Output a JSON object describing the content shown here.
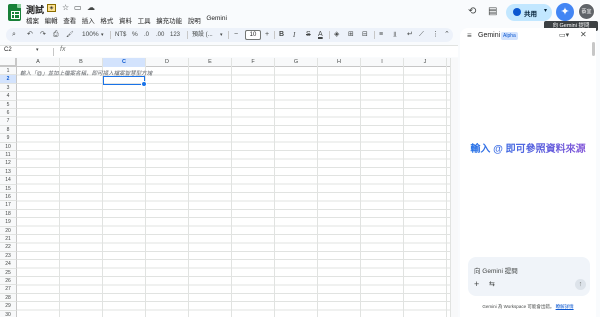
{
  "app": {
    "doc_title": "測試",
    "menu": [
      "檔案",
      "編輯",
      "查看",
      "插入",
      "格式",
      "資料",
      "工具",
      "擴充功能",
      "說明",
      "Gemini"
    ]
  },
  "header": {
    "share_label": "共用",
    "avatar_label": "蔡宜",
    "tooltip": "向 Gemini 提問",
    "icons": [
      "history-icon",
      "comment-icon",
      "globe-icon",
      "gemini-spark-icon"
    ]
  },
  "toolbar": {
    "search_icon": "⌕",
    "undo": "↶",
    "redo": "↷",
    "print": "⎙",
    "paint": "🖌",
    "zoom": "100%",
    "currency": "NT$",
    "percent": "%",
    "dec_decrease": ".0",
    "dec_increase": ".00",
    "number_format": "123",
    "font": "預設 (...",
    "font_minus": "−",
    "font_size": "10",
    "font_plus": "+",
    "bold": "B",
    "italic": "I",
    "strike": "S",
    "text_color": "A",
    "fill": "◈",
    "borders": "⊞",
    "merge": "⊟",
    "align": "≡",
    "valign": "⫫",
    "wrap": "↵",
    "rotate": "⟋",
    "more": "⋮",
    "collapse": "⌃"
  },
  "formula_bar": {
    "name_box": "C2",
    "fx": "fx"
  },
  "grid": {
    "columns": [
      "A",
      "B",
      "C",
      "D",
      "E",
      "F",
      "G",
      "H",
      "I",
      "J"
    ],
    "selected_column": "C",
    "rows": [
      "1",
      "2",
      "3",
      "4",
      "5",
      "6",
      "7",
      "8",
      "9",
      "10",
      "11",
      "12",
      "13",
      "14",
      "15",
      "16",
      "17",
      "18",
      "19",
      "20",
      "21",
      "22",
      "23",
      "24",
      "25",
      "26",
      "27",
      "28",
      "29",
      "30"
    ],
    "selected_row": "2",
    "placeholder": "輸入「@」並加上檔案名稱，即可插入檔案智慧型方塊"
  },
  "gemini_panel": {
    "title": "Gemini",
    "badge": "Alpha",
    "hint": "輸入 @ 即可參照資料來源",
    "prompt_placeholder": "向 Gemini 提問",
    "disclaimer_text": "Gemini 為 Workspace 可能會出錯。",
    "disclaimer_link": "瞭解詳情"
  },
  "colors": {
    "accent": "#0b57d0",
    "share_bg": "#c2e7ff",
    "selection": "#1a73e8",
    "sheets_green": "#188038"
  }
}
